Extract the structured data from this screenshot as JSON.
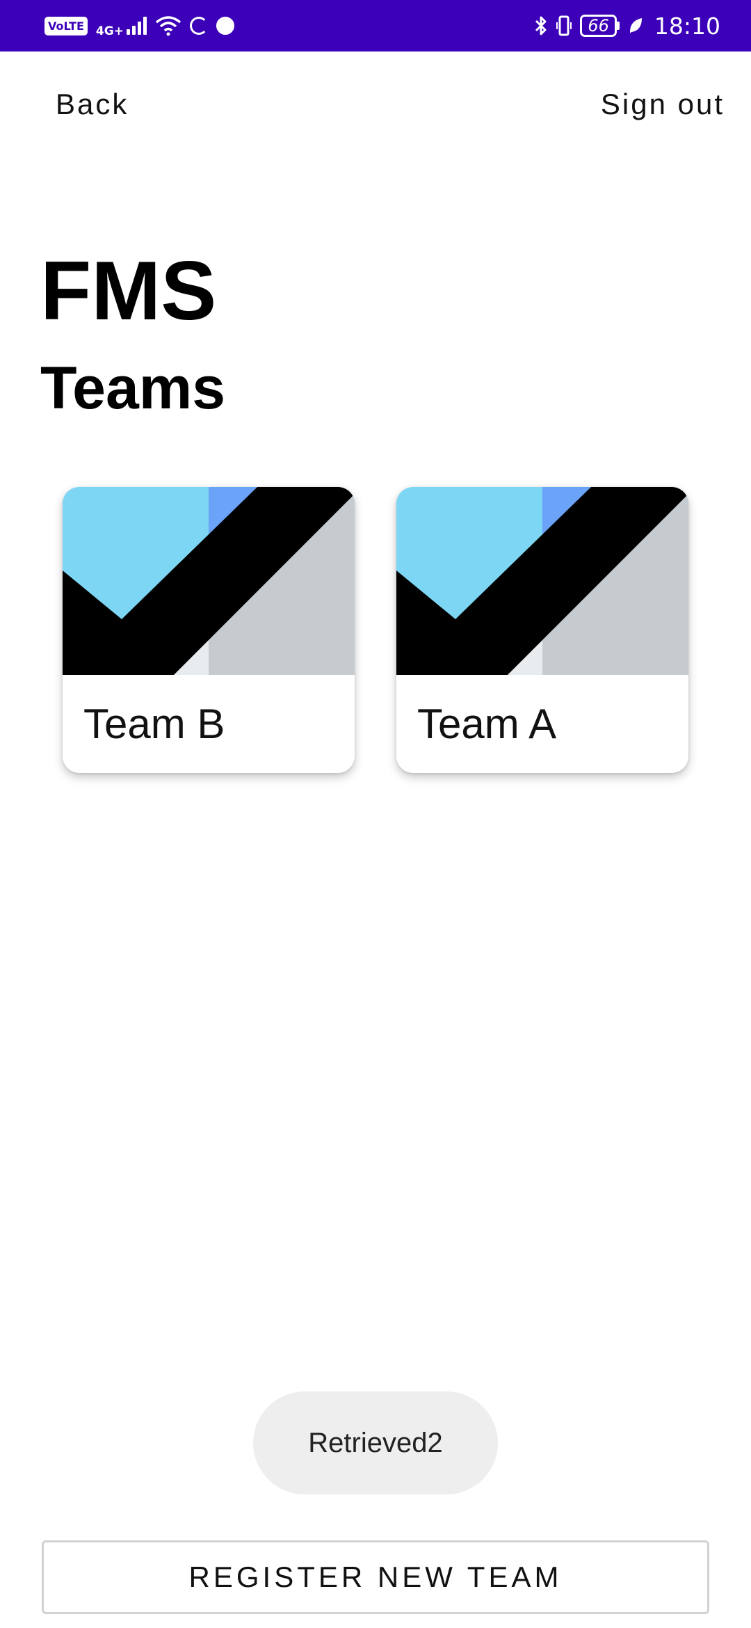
{
  "status_bar": {
    "network_label": "4G+",
    "volte_label": "VoLTE",
    "battery_level": "66",
    "time": "18:10",
    "background_color": "#3b00b8"
  },
  "nav": {
    "back_label": "Back",
    "sign_out_label": "Sign out"
  },
  "header": {
    "app_title": "FMS",
    "section_title": "Teams"
  },
  "teams": [
    {
      "name": "Team B",
      "thumbnail_icon": "placeholder-image-icon"
    },
    {
      "name": "Team A",
      "thumbnail_icon": "placeholder-image-icon"
    }
  ],
  "toast": {
    "message": "Retrieved2"
  },
  "actions": {
    "register_label": "REGISTER NEW TEAM"
  },
  "colors": {
    "thumb_sky": "#7dd6f4",
    "thumb_blue": "#6aa3f7",
    "thumb_gray": "#c5cbce",
    "thumb_light": "#e8ecee",
    "thumb_black": "#000000"
  }
}
